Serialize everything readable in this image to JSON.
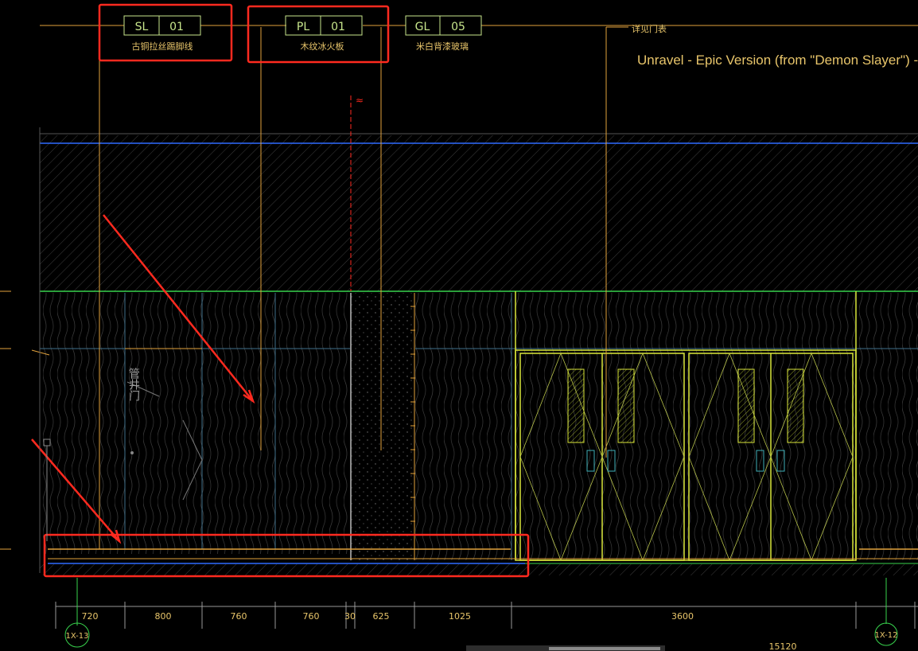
{
  "tags": [
    {
      "code": "SL",
      "num": "01",
      "desc": "古铜拉丝踢脚线"
    },
    {
      "code": "PL",
      "num": "01",
      "desc": "木纹冰火板"
    },
    {
      "code": "GL",
      "num": "05",
      "desc": "米白背漆玻璃"
    }
  ],
  "door_note": "详见门表",
  "shaft_label": "管井门",
  "overlay_title": "Unravel - Epic Version (from \"Demon Slayer\") - S",
  "dimensions": [
    "720",
    "800",
    "760",
    "760",
    "30",
    "625",
    "1025",
    "3600"
  ],
  "total_dimension": "15120",
  "grid_axes": [
    "1X-13",
    "1X-12"
  ],
  "colors": {
    "annotation": "#e2a23c",
    "highlight": "#ff2a1f",
    "wall_line": "#2f6bff",
    "ceiling_line": "#38d34d",
    "door_frame": "#d8e53a",
    "tag": "#c8e68c"
  }
}
